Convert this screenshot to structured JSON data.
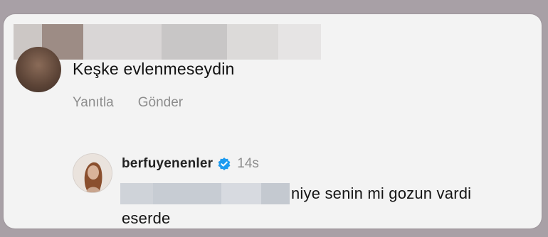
{
  "comment": {
    "text": "Keşke evlenmeseydin",
    "actions": [
      "Yanıtla",
      "Gönder"
    ]
  },
  "reply": {
    "username": "berfuyenenler",
    "timestamp": "14s",
    "text_line1": "niye senin mi gozun vardi",
    "text_line2": "eserde",
    "verified_icon": "verified-badge-icon"
  },
  "colors": {
    "card_bg": "#f3f3f3",
    "secondary_text": "#8d8d8d",
    "verified_blue": "#1d9bf0"
  }
}
